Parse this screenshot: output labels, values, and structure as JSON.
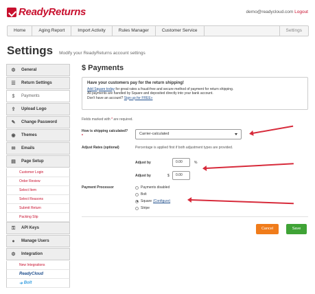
{
  "header": {
    "logo_text": "ReadyReturns",
    "user_email": "demo@readycloud.com",
    "logout_label": "Logout"
  },
  "nav": {
    "items": [
      "Home",
      "Aging Report",
      "Import Activity",
      "Rules Manager",
      "Customer Service"
    ],
    "settings_label": "Settings"
  },
  "page": {
    "title": "Settings",
    "subtitle": "Modify your ReadyReturns account settings"
  },
  "sidebar": {
    "items": [
      {
        "label": "General",
        "icon": "gear-icon"
      },
      {
        "label": "Return Settings",
        "icon": "list-icon"
      },
      {
        "label": "Payments",
        "icon": "dollar-icon"
      },
      {
        "label": "Upload Logo",
        "icon": "upload-icon"
      },
      {
        "label": "Change Password",
        "icon": "pencil-icon"
      },
      {
        "label": "Themes",
        "icon": "eye-icon"
      },
      {
        "label": "Emails",
        "icon": "envelope-icon"
      },
      {
        "label": "Page Setup",
        "icon": "document-icon"
      },
      {
        "label": "API Keys",
        "icon": "key-icon"
      },
      {
        "label": "Manage Users",
        "icon": "user-icon"
      },
      {
        "label": "Integration",
        "icon": "gear-icon"
      }
    ],
    "page_setup_subs": [
      "Customer Login",
      "Order Review",
      "Select Item",
      "Select Reasons",
      "Submit Return",
      "Packing Slip"
    ],
    "integration_subs": [
      "New Integrations"
    ],
    "integration_logos": [
      "ReadyCloud",
      "Bolt"
    ]
  },
  "payments": {
    "title": "$ Payments",
    "promo_heading": "Have your customers pay for the return shipping!",
    "promo_link": "Add Square today",
    "promo_line1": " for great rates a fraud-free and secure method of payment for return shipping.",
    "promo_line2": "All payments are handled by Square and deposited directly into your bank account.",
    "promo_line3": "Don't have an account? ",
    "promo_signup": "Sign up for FREE»",
    "required_note": "Fields marked with ",
    "required_star": "*",
    "required_suffix": " are required.",
    "shipping_label": "How is shipping calculated?",
    "shipping_star": "*",
    "shipping_value": "Carrier-calculated",
    "adjust_label": "Adjust Rates (optional)",
    "pct_note": "Percentage is applied first if both adjustment types are provided.",
    "adjust_by_pct_label": "Adjust by",
    "adjust_by_pct_value": "0.00",
    "pct_unit": "%",
    "adjust_by_amt_label": "Adjust by",
    "amt_unit": "$",
    "adjust_by_amt_value": "0.00",
    "processor_label": "Payment Processor",
    "processor_options": [
      "Payments disabled",
      "Bolt",
      "Square",
      "Stripe"
    ],
    "processor_selected": "Square",
    "configure_label": "(Configure)",
    "cancel_label": "Cancel",
    "save_label": "Save"
  },
  "colors": {
    "brand": "#c8102e",
    "arrow": "#d72a3a",
    "cancel": "#f07c1b",
    "save": "#3fa336",
    "link": "#1f4e8c"
  }
}
